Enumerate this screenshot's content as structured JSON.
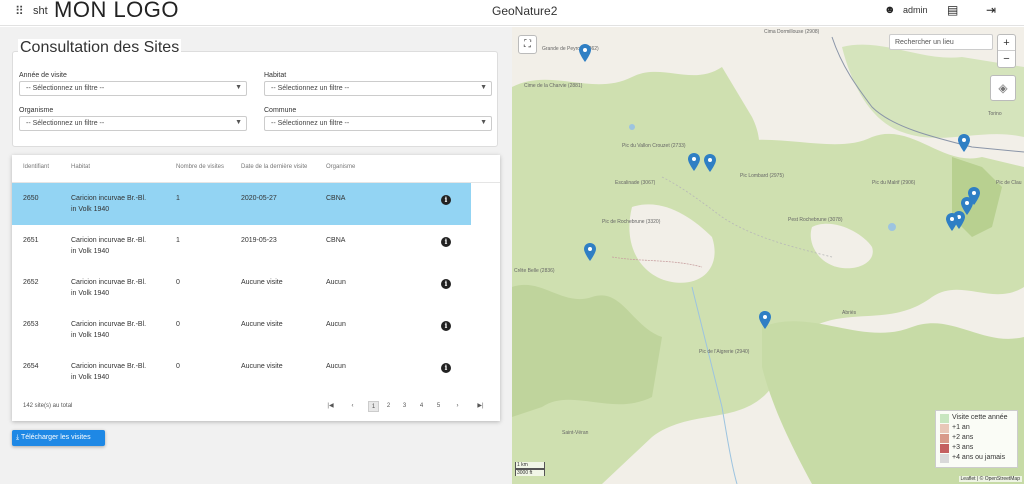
{
  "nav": {
    "apps_icon": "grid-icon",
    "sht": "sht",
    "logo": "MON LOGO",
    "app_name": "GeoNature2",
    "user": "admin"
  },
  "page": {
    "title": "Consultation des Sites"
  },
  "filters": {
    "year_label": "Année de visite",
    "year_value": "-- Sélectionnez un filtre --",
    "habitat_label": "Habitat",
    "habitat_value": "-- Sélectionnez un filtre --",
    "org_label": "Organisme",
    "org_value": "-- Sélectionnez un filtre --",
    "commune_label": "Commune",
    "commune_value": "-- Sélectionnez un filtre --"
  },
  "table": {
    "headers": [
      "Identifiant",
      "Habitat",
      "Nombre de visites",
      "Date de la dernière visite",
      "Organisme"
    ],
    "rows": [
      {
        "id": "2650",
        "hab1": "Caricion incurvae Br.-Bl.",
        "hab2": "in Volk 1940",
        "visits": "1",
        "date": "2020-05-27",
        "org": "CBNA"
      },
      {
        "id": "2651",
        "hab1": "Caricion incurvae Br.-Bl.",
        "hab2": "in Volk 1940",
        "visits": "1",
        "date": "2019-05-23",
        "org": "CBNA"
      },
      {
        "id": "2652",
        "hab1": "Caricion incurvae Br.-Bl.",
        "hab2": "in Volk 1940",
        "visits": "0",
        "date": "Aucune visite",
        "org": "Aucun"
      },
      {
        "id": "2653",
        "hab1": "Caricion incurvae Br.-Bl.",
        "hab2": "in Volk 1940",
        "visits": "0",
        "date": "Aucune visite",
        "org": "Aucun"
      },
      {
        "id": "2654",
        "hab1": "Caricion incurvae Br.-Bl.",
        "hab2": "in Volk 1940",
        "visits": "0",
        "date": "Aucune visite",
        "org": "Aucun"
      }
    ],
    "total": "142 site(s) au total",
    "pages": [
      "1",
      "2",
      "3",
      "4",
      "5"
    ],
    "first": "|◀",
    "prev": "‹",
    "next": "›",
    "last": "▶|"
  },
  "download_label": "Télécharger les visites",
  "map": {
    "search_placeholder": "Rechercher un lieu",
    "zoom_in": "+",
    "zoom_out": "−",
    "labels": [
      "Cima Dormillouse (2908)",
      "Grande de Peyron (2862)",
      "Cime de la Charvie (2881)",
      "Pic du Vallon Crouzet (2733)",
      "Escalinade (3067)",
      "Pic Lombard (2975)",
      "Pic du Malrif (2906)",
      "Pic de Rochebrune (3320)",
      "Pest Rochebrune (3078)",
      "Crête Belle (2836)",
      "Pic de l'Aigrerie (2940)",
      "Pic de Clau",
      "Torino",
      "Saint-Véran",
      "Abriès"
    ],
    "legend": [
      {
        "label": "Visite cette année",
        "color": "#c8e6c0"
      },
      {
        "label": "+1 an",
        "color": "#e8c7b8"
      },
      {
        "label": "+2 ans",
        "color": "#d89a8a"
      },
      {
        "label": "+3 ans",
        "color": "#c46060"
      },
      {
        "label": "+4 ans ou jamais",
        "color": "#d9d9d9"
      }
    ],
    "scale_km": "1 km",
    "scale_ft": "3000 ft",
    "attribution": "Leaflet | © OpenStreetMap"
  }
}
